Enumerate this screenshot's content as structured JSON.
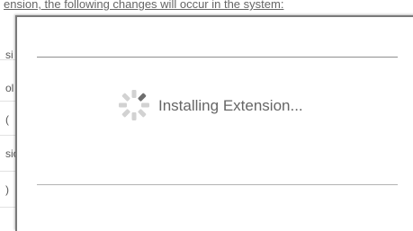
{
  "background": {
    "header_text": "ension, the following changes will occur in the system:",
    "rows": [
      "si",
      "ol",
      "(",
      "sio",
      ")"
    ]
  },
  "modal": {
    "status_text": "Installing Extension...",
    "spinner_icon": "loading-spinner-icon"
  },
  "colors": {
    "text": "#666666",
    "spinner_active": "#6e6e6e",
    "spinner_inactive": "#d2d2d2",
    "rule": "#8f8f8f"
  }
}
